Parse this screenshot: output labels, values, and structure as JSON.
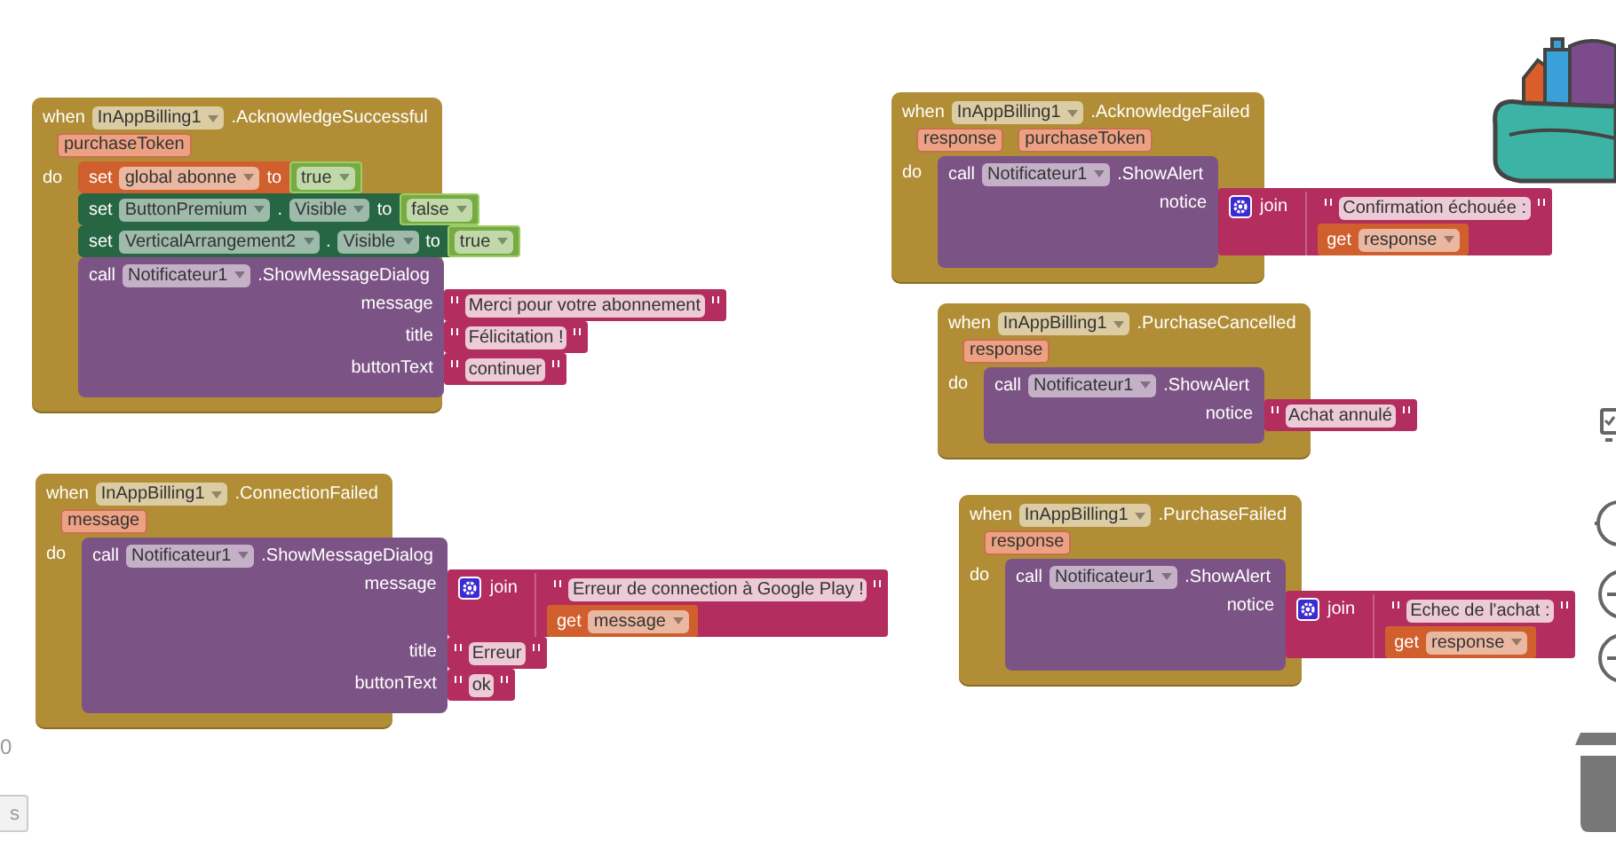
{
  "workspace": {
    "events": [
      {
        "when": "when",
        "component": "InAppBilling1",
        "event": ".AcknowledgeSuccessful",
        "params": [
          "purchaseToken"
        ],
        "do": "do",
        "body": [
          {
            "kind": "set_var",
            "set": "set",
            "variable": "global abonne",
            "to": "to",
            "value": {
              "kind": "bool",
              "value": "true"
            }
          },
          {
            "kind": "set_prop",
            "set": "set",
            "component": "ButtonPremium",
            "dot": ".",
            "property": "Visible",
            "to": "to",
            "value": {
              "kind": "bool",
              "value": "false"
            }
          },
          {
            "kind": "set_prop",
            "set": "set",
            "component": "VerticalArrangement2",
            "dot": ".",
            "property": "Visible",
            "to": "to",
            "value": {
              "kind": "bool",
              "value": "true"
            }
          },
          {
            "kind": "call",
            "call": "call",
            "component": "Notificateur1",
            "method": ".ShowMessageDialog",
            "args": [
              {
                "name": "message",
                "value": {
                  "kind": "text",
                  "text": "Merci pour votre abonnement"
                }
              },
              {
                "name": "title",
                "value": {
                  "kind": "text",
                  "text": "Félicitation !"
                }
              },
              {
                "name": "buttonText",
                "value": {
                  "kind": "text",
                  "text": "continuer"
                }
              }
            ]
          }
        ]
      },
      {
        "when": "when",
        "component": "InAppBilling1",
        "event": ".AcknowledgeFailed",
        "params": [
          "response",
          "purchaseToken"
        ],
        "do": "do",
        "body": [
          {
            "kind": "call",
            "call": "call",
            "component": "Notificateur1",
            "method": ".ShowAlert",
            "args": [
              {
                "name": "notice",
                "value": {
                  "kind": "join",
                  "join": "join",
                  "items": [
                    {
                      "kind": "text",
                      "text": "Confirmation échouée :"
                    },
                    {
                      "kind": "get",
                      "get": "get",
                      "name": "response"
                    }
                  ]
                }
              }
            ]
          }
        ]
      },
      {
        "when": "when",
        "component": "InAppBilling1",
        "event": ".PurchaseCancelled",
        "params": [
          "response"
        ],
        "do": "do",
        "body": [
          {
            "kind": "call",
            "call": "call",
            "component": "Notificateur1",
            "method": ".ShowAlert",
            "args": [
              {
                "name": "notice",
                "value": {
                  "kind": "text",
                  "text": "Achat annulé"
                }
              }
            ]
          }
        ]
      },
      {
        "when": "when",
        "component": "InAppBilling1",
        "event": ".ConnectionFailed",
        "params": [
          "message"
        ],
        "do": "do",
        "body": [
          {
            "kind": "call",
            "call": "call",
            "component": "Notificateur1",
            "method": ".ShowMessageDialog",
            "args": [
              {
                "name": "message",
                "value": {
                  "kind": "join",
                  "join": "join",
                  "items": [
                    {
                      "kind": "text",
                      "text": "Erreur de connection à Google Play !"
                    },
                    {
                      "kind": "get",
                      "get": "get",
                      "name": "message"
                    }
                  ]
                }
              },
              {
                "name": "title",
                "value": {
                  "kind": "text",
                  "text": "Erreur"
                }
              },
              {
                "name": "buttonText",
                "value": {
                  "kind": "text",
                  "text": "ok"
                }
              }
            ]
          }
        ]
      },
      {
        "when": "when",
        "component": "InAppBilling1",
        "event": ".PurchaseFailed",
        "params": [
          "response"
        ],
        "do": "do",
        "body": [
          {
            "kind": "call",
            "call": "call",
            "component": "Notificateur1",
            "method": ".ShowAlert",
            "args": [
              {
                "name": "notice",
                "value": {
                  "kind": "join",
                  "join": "join",
                  "items": [
                    {
                      "kind": "text",
                      "text": "Echec de l'achat :"
                    },
                    {
                      "kind": "get",
                      "get": "get",
                      "name": "response"
                    }
                  ]
                }
              }
            ]
          }
        ]
      }
    ]
  },
  "edge_text": "0",
  "edge_button": {
    "label": "s"
  }
}
